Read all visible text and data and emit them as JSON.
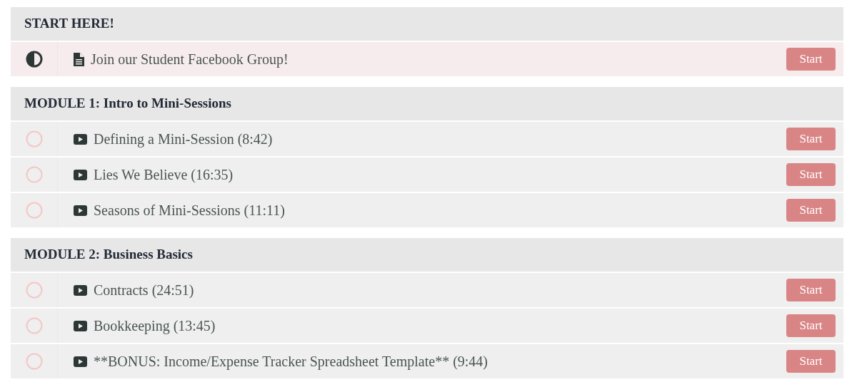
{
  "sections": [
    {
      "title": "START HERE!",
      "lessons": [
        {
          "in_progress": true,
          "kind": "document",
          "title": "Join our Student Facebook Group!",
          "button": "Start"
        }
      ]
    },
    {
      "title": "MODULE 1: Intro to Mini-Sessions",
      "lessons": [
        {
          "in_progress": false,
          "kind": "video",
          "title": "Defining a Mini-Session (8:42)",
          "button": "Start"
        },
        {
          "in_progress": false,
          "kind": "video",
          "title": "Lies We Believe (16:35)",
          "button": "Start"
        },
        {
          "in_progress": false,
          "kind": "video",
          "title": "Seasons of Mini-Sessions (11:11)",
          "button": "Start"
        }
      ]
    },
    {
      "title": "MODULE 2: Business Basics",
      "lessons": [
        {
          "in_progress": false,
          "kind": "video",
          "title": "Contracts (24:51)",
          "button": "Start"
        },
        {
          "in_progress": false,
          "kind": "video",
          "title": "Bookkeeping (13:45)",
          "button": "Start"
        },
        {
          "in_progress": false,
          "kind": "video",
          "title": "**BONUS: Income/Expense Tracker Spreadsheet Template** (9:44)",
          "button": "Start"
        }
      ]
    }
  ]
}
